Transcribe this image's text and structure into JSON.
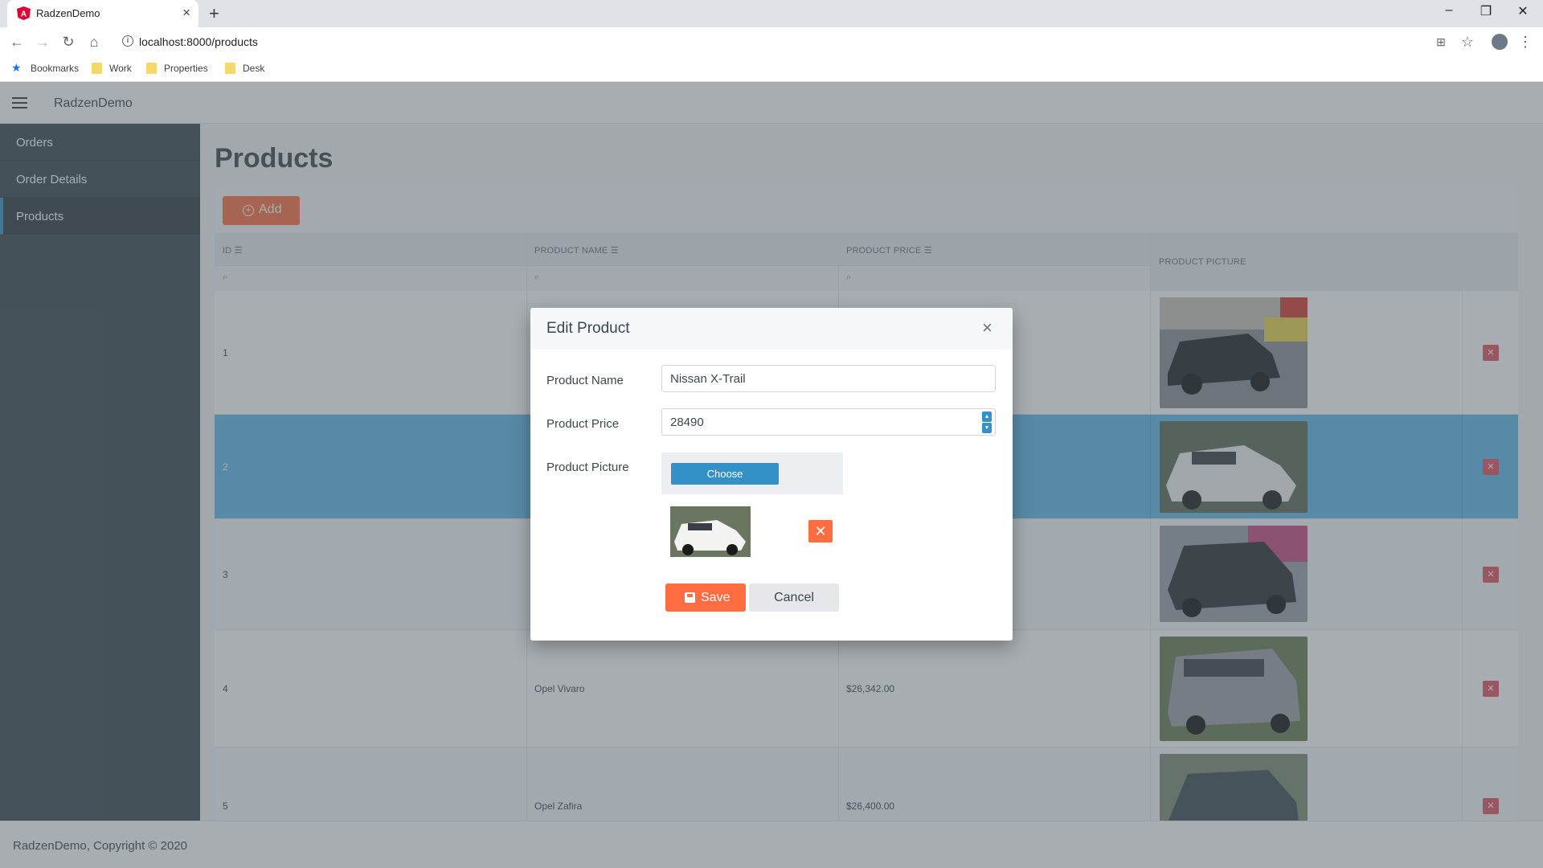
{
  "browser": {
    "tab_title": "RadzenDemo",
    "url": "localhost:8000/products",
    "bookmarks": [
      "Bookmarks",
      "Work",
      "Properties",
      "Desk"
    ]
  },
  "app": {
    "title": "RadzenDemo",
    "sidebar": {
      "items": [
        {
          "label": "Orders",
          "active": false
        },
        {
          "label": "Order Details",
          "active": false
        },
        {
          "label": "Products",
          "active": true
        }
      ]
    },
    "page_title": "Products",
    "add_label": "Add",
    "columns": {
      "id": "ID",
      "name": "PRODUCT NAME",
      "price": "PRODUCT PRICE",
      "picture": "PRODUCT PICTURE"
    },
    "rows": [
      {
        "id": "1",
        "name": "",
        "price": ""
      },
      {
        "id": "2",
        "name": "",
        "price": ""
      },
      {
        "id": "3",
        "name": "",
        "price": ""
      },
      {
        "id": "4",
        "name": "Opel Vivaro",
        "price": "$26,342.00"
      },
      {
        "id": "5",
        "name": "Opel Zafira",
        "price": "$26,400.00"
      }
    ],
    "selected_row": 2,
    "footer": "RadzenDemo, Copyright © 2020"
  },
  "dialog": {
    "title": "Edit Product",
    "name_label": "Product Name",
    "name_value": "Nissan X-Trail",
    "price_label": "Product Price",
    "price_value": "28490",
    "picture_label": "Product Picture",
    "choose_label": "Choose",
    "save_label": "Save",
    "cancel_label": "Cancel"
  },
  "colors": {
    "accent": "#ff6d41",
    "primary": "#3491c8",
    "sidebar": "#3a474d",
    "selected_row": "#5fb8ea"
  }
}
